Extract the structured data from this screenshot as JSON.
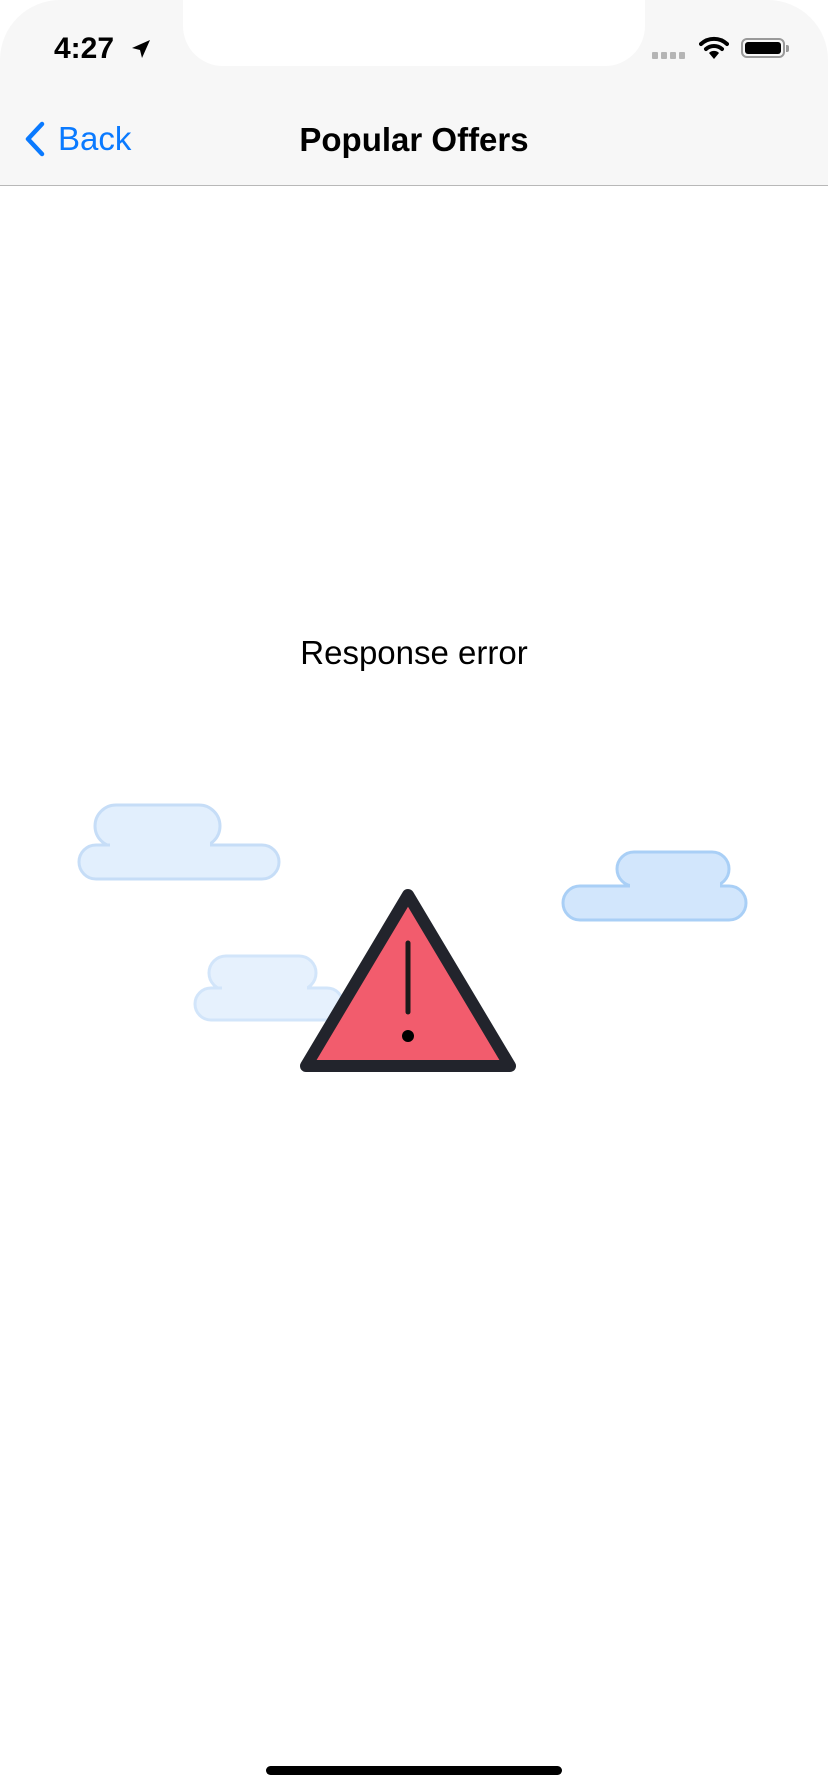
{
  "status_bar": {
    "time": "4:27",
    "icons": [
      "location-arrow-icon",
      "signal-icon",
      "wifi-icon",
      "battery-icon"
    ]
  },
  "nav": {
    "back_label": "Back",
    "title": "Popular Offers"
  },
  "main": {
    "message": "Response error",
    "illustration": "warning-triangle-with-clouds"
  },
  "colors": {
    "accent": "#0a7aff",
    "warning_fill": "#f25c6d",
    "warning_stroke": "#22242c",
    "cloud_fill": "#e1effd",
    "cloud_stroke": "#b9d9f9"
  }
}
